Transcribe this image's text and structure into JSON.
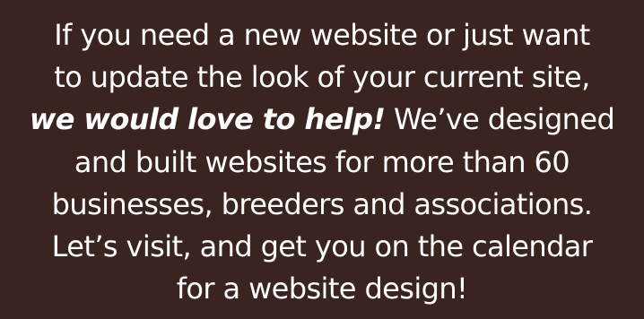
{
  "message": {
    "line1": "If you need a new website or just want",
    "line2": "to update the look of your current site,",
    "line3_emphasis": "we would love to help!",
    "line3_rest": " We’ve designed",
    "line4": "and built websites for more than 60",
    "line5": "businesses, breeders and associations.",
    "line6": "Let’s visit, and get you on the calendar",
    "line7": "for a website design!"
  },
  "colors": {
    "background": "#3a2420",
    "text": "#ffffff"
  }
}
